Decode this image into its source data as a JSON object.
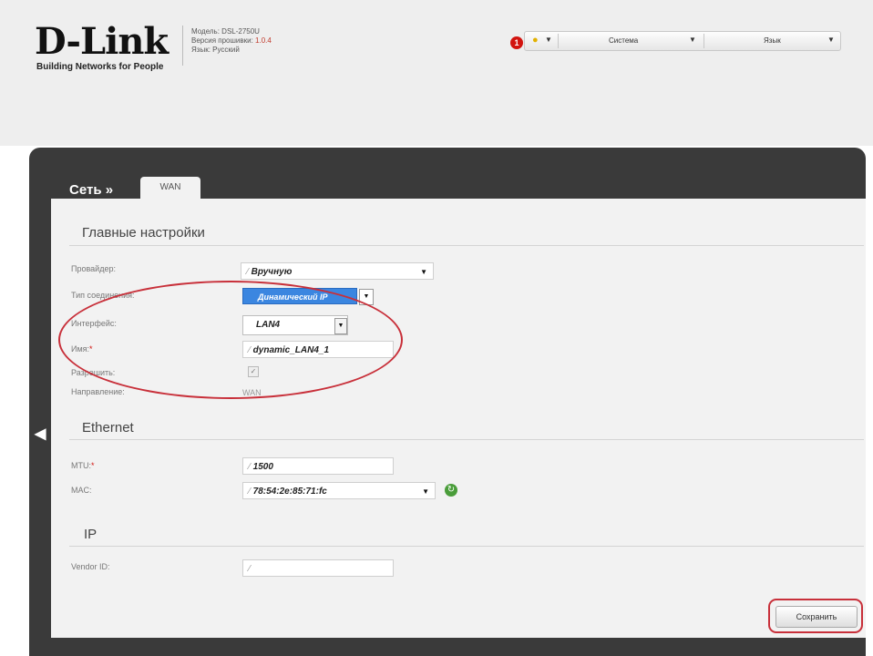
{
  "header": {
    "logo_text": "D-Link",
    "tagline": "Building Networks for People",
    "model_label": "Модель: DSL-2750U",
    "firmware_label": "Версия прошивки: ",
    "firmware_value": "1.0.4",
    "language_label": "Язык: Русский",
    "notification_count": "1",
    "system_menu": "Система",
    "language_menu": "Язык"
  },
  "breadcrumb": {
    "section": "Сеть »",
    "tab": "WAN"
  },
  "main_settings": {
    "title": "Главные настройки",
    "provider_label": "Провайдер:",
    "provider_value": "Вручную",
    "connection_type_label": "Тип соединения:",
    "connection_type_value": "Динамический IP",
    "interface_label": "Интерфейс:",
    "interface_value": "LAN4",
    "name_label": "Имя:",
    "name_value": "dynamic_LAN4_1",
    "enable_label": "Разрешить:",
    "direction_label": "Направление:",
    "direction_value": "WAN"
  },
  "ethernet": {
    "title": "Ethernet",
    "mtu_label": "MTU:",
    "mtu_value": "1500",
    "mac_label": "MAC:",
    "mac_value": "78:54:2e:85:71:fc"
  },
  "ip": {
    "title": "IP",
    "vendor_label": "Vendor ID:",
    "vendor_value": ""
  },
  "actions": {
    "save_label": "Сохранить"
  },
  "colors": {
    "panel_dark": "#3a3a3a",
    "selected_blue": "#3b86e0",
    "annotation_red": "#c8303a"
  }
}
